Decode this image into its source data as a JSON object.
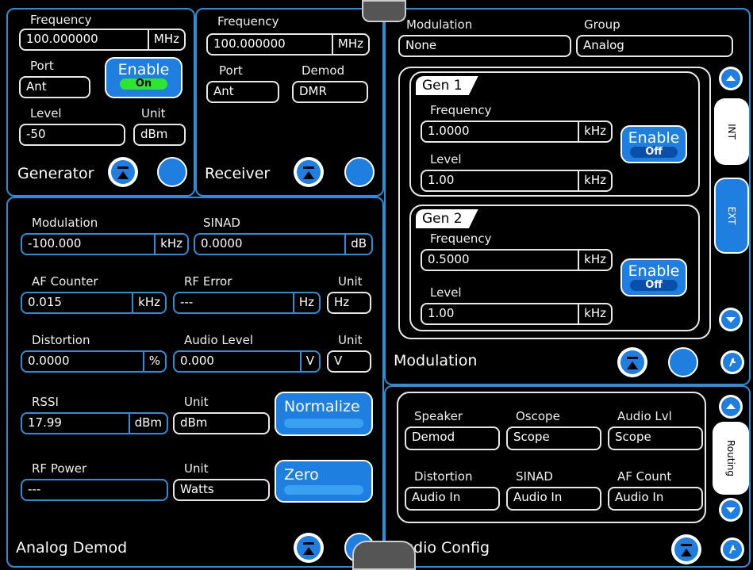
{
  "generator": {
    "frequency_label": "Frequency",
    "frequency_value": "100.000000",
    "frequency_unit": "MHz",
    "port_label": "Port",
    "port_value": "Ant",
    "enable_label": "Enable",
    "enable_state": "On",
    "level_label": "Level",
    "level_value": "-50",
    "unit_label": "Unit",
    "unit_value": "dBm",
    "title": "Generator"
  },
  "receiver": {
    "frequency_label": "Frequency",
    "frequency_value": "100.000000",
    "frequency_unit": "MHz",
    "port_label": "Port",
    "port_value": "Ant",
    "demod_label": "Demod",
    "demod_value": "DMR",
    "title": "Receiver"
  },
  "analog_demod": {
    "title": "Analog Demod",
    "modulation_label": "Modulation",
    "modulation_value": "-100.000",
    "modulation_unit": "kHz",
    "sinad_label": "SINAD",
    "sinad_value": "0.0000",
    "sinad_unit": "dB",
    "af_counter_label": "AF Counter",
    "af_counter_value": "0.015",
    "af_counter_unit": "kHz",
    "rf_error_label": "RF Error",
    "rf_error_value": "---",
    "rf_error_unit": "Hz",
    "rf_error_sel_label": "Unit",
    "rf_error_sel_value": "Hz",
    "distortion_label": "Distortion",
    "distortion_value": "0.0000",
    "distortion_unit": "%",
    "audio_level_label": "Audio Level",
    "audio_level_value": "0.000",
    "audio_level_unit": "V",
    "audio_level_sel_label": "Unit",
    "audio_level_sel_value": "V",
    "rssi_label": "RSSI",
    "rssi_value": "17.99",
    "rssi_unit": "dBm",
    "rssi_sel_label": "Unit",
    "rssi_sel_value": "dBm",
    "normalize_label": "Normalize",
    "rf_power_label": "RF Power",
    "rf_power_value": "---",
    "rf_power_sel_label": "Unit",
    "rf_power_sel_value": "Watts",
    "zero_label": "Zero"
  },
  "modulation": {
    "title": "Modulation",
    "modulation_label": "Modulation",
    "modulation_value": "None",
    "group_label": "Group",
    "group_value": "Analog",
    "gen1": {
      "title": "Gen 1",
      "frequency_label": "Frequency",
      "frequency_value": "1.0000",
      "frequency_unit": "kHz",
      "level_label": "Level",
      "level_value": "1.00",
      "level_unit": "kHz",
      "enable_label": "Enable",
      "enable_state": "Off"
    },
    "gen2": {
      "title": "Gen 2",
      "frequency_label": "Frequency",
      "frequency_value": "0.5000",
      "frequency_unit": "kHz",
      "level_label": "Level",
      "level_value": "1.00",
      "level_unit": "kHz",
      "enable_label": "Enable",
      "enable_state": "Off"
    },
    "tab_int": "INT",
    "tab_ext": "EXT"
  },
  "audio_config": {
    "title": "Audio Config",
    "speaker_label": "Speaker",
    "speaker_value": "Demod",
    "oscope_label": "Oscope",
    "oscope_value": "Scope",
    "audio_lvl_label": "Audio Lvl",
    "audio_lvl_value": "Scope",
    "distortion_label": "Distortion",
    "distortion_value": "Audio In",
    "sinad_label": "SINAD",
    "sinad_value": "Audio In",
    "af_count_label": "AF Count",
    "af_count_value": "Audio In",
    "tab_routing": "Routing"
  },
  "colors": {
    "accent": "#1e7fe0",
    "border": "#2a8fd6",
    "on": "#2ee62e"
  }
}
